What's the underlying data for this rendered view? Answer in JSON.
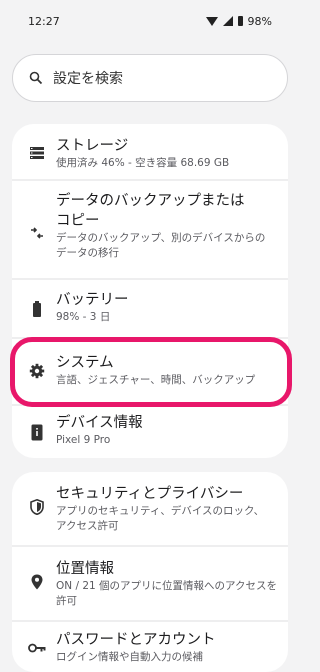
{
  "status": {
    "time": "12:27",
    "battery": "98%"
  },
  "search": {
    "label": "設定を検索"
  },
  "items": [
    {
      "title": "ストレージ",
      "subtitle": "使用済み 46% - 空き容量 68.69 GB"
    },
    {
      "title": "データのバックアップまたは",
      "title2": "コピー",
      "subtitle": "データのバックアップ、別のデバイスからの",
      "subtitle2": "データの移行"
    },
    {
      "title": "バッテリー",
      "subtitle": "98% - 3 日"
    },
    {
      "title": "システム",
      "subtitle": "言語、ジェスチャー、時間、バックアップ"
    },
    {
      "title": "デバイス情報",
      "subtitle": "Pixel 9 Pro"
    },
    {
      "title": "セキュリティとプライバシー",
      "subtitle": "アプリのセキュリティ、デバイスのロック、",
      "subtitle2": "アクセス許可"
    },
    {
      "title": "位置情報",
      "subtitle": "ON / 21 個のアプリに位置情報へのアクセスを",
      "subtitle2": "許可"
    },
    {
      "title": "パスワードとアカウント",
      "subtitle": "ログイン情報や自動入力の候補"
    }
  ],
  "colors": {
    "highlight": "#e8176a",
    "background": "#f3f3f4",
    "card": "#ffffff"
  }
}
